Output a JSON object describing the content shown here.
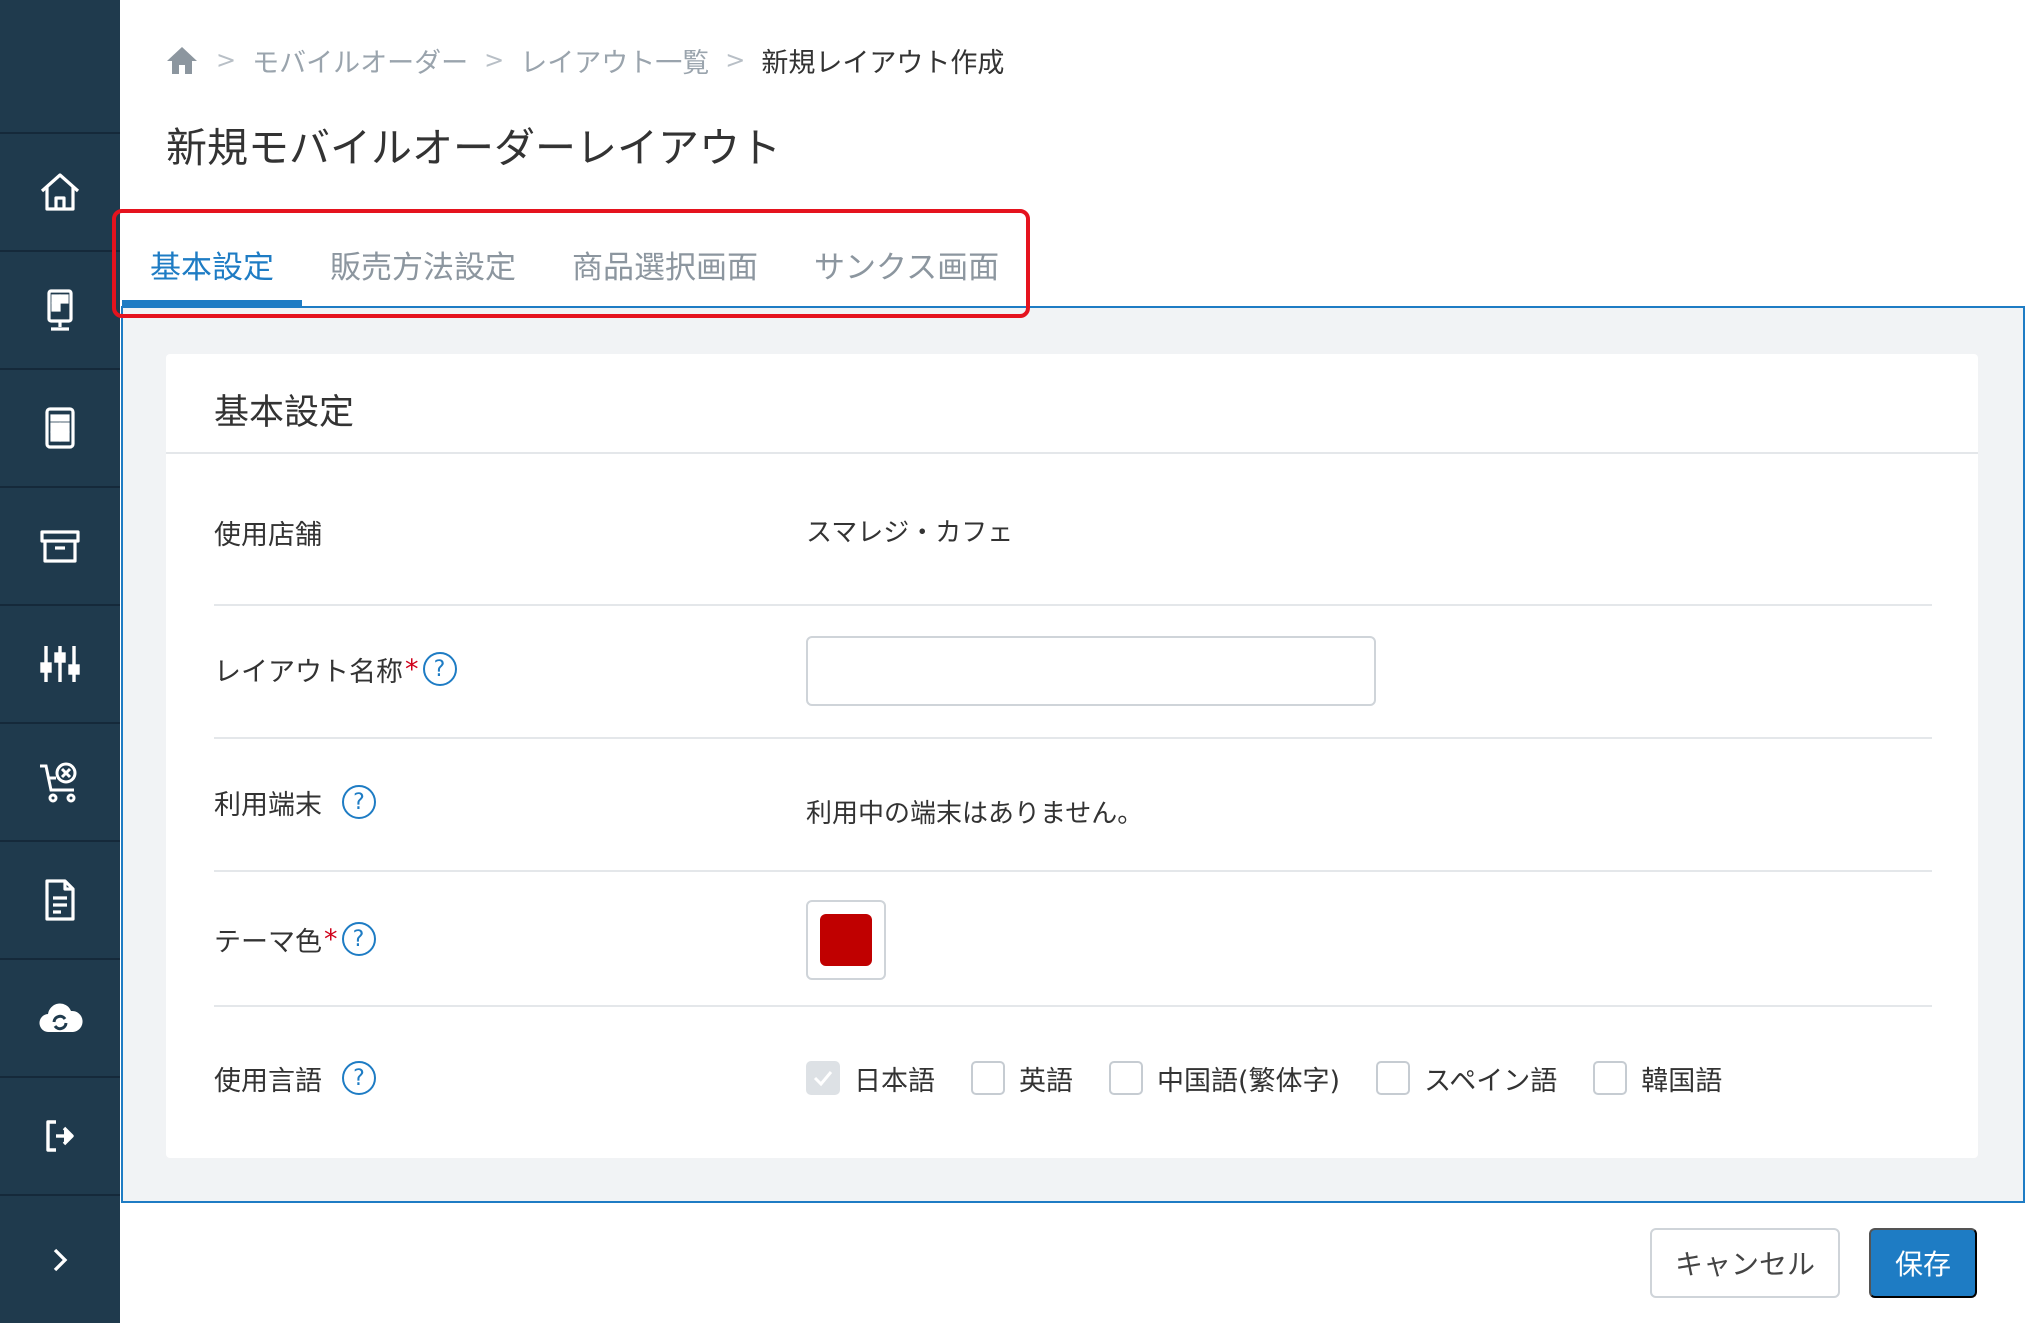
{
  "breadcrumb": {
    "home_icon": "home-icon",
    "items": [
      "モバイルオーダー",
      "レイアウト一覧"
    ],
    "current": "新規レイアウト作成"
  },
  "page_title": "新規モバイルオーダーレイアウト",
  "tabs": [
    {
      "label": "基本設定",
      "active": true
    },
    {
      "label": "販売方法設定",
      "active": false
    },
    {
      "label": "商品選択画面",
      "active": false
    },
    {
      "label": "サンクス画面",
      "active": false
    }
  ],
  "sidebar": {
    "icons": [
      "home-icon",
      "kiosk-icon",
      "tablet-layout-icon",
      "archive-box-icon",
      "sliders-icon",
      "cart-cancel-icon",
      "document-icon",
      "cloud-sync-icon",
      "logout-icon",
      "chevron-right-icon"
    ]
  },
  "card": {
    "title": "基本設定",
    "rows": {
      "store": {
        "label": "使用店舗",
        "value": "スマレジ・カフェ"
      },
      "layout_name": {
        "label": "レイアウト名称",
        "required": "*",
        "help": "?",
        "value": "",
        "placeholder": ""
      },
      "terminal": {
        "label": "利用端末",
        "help": "?",
        "value": "利用中の端末はありません。"
      },
      "theme_color": {
        "label": "テーマ色",
        "required": "*",
        "help": "?",
        "color": "#c00000"
      },
      "languages": {
        "label": "使用言語",
        "help": "?",
        "options": [
          {
            "label": "日本語",
            "checked": true
          },
          {
            "label": "英語",
            "checked": false
          },
          {
            "label": "中国語(繁体字)",
            "checked": false
          },
          {
            "label": "スペイン語",
            "checked": false
          },
          {
            "label": "韓国語",
            "checked": false
          }
        ]
      }
    }
  },
  "footer": {
    "cancel_label": "キャンセル",
    "save_label": "保存"
  },
  "colors": {
    "sidebar": "#1f3a4d",
    "accent": "#1e7cc4",
    "highlight_box": "#e5131e",
    "required": "#d0021b"
  }
}
